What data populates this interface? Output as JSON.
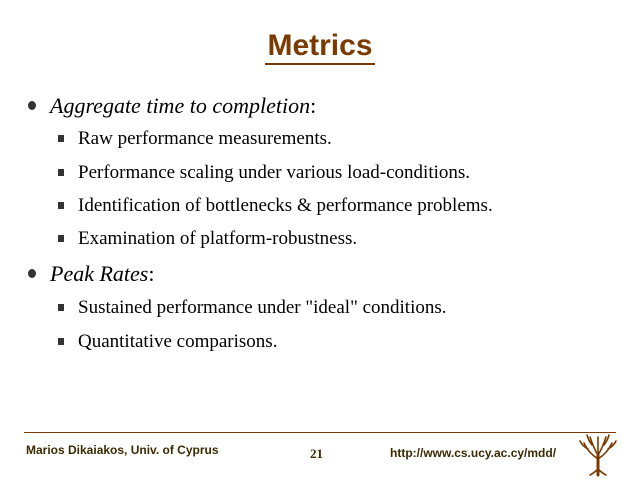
{
  "slide": {
    "title": "Metrics"
  },
  "bullets": [
    {
      "label": "Aggregate time to completion",
      "suffix": ":",
      "items": [
        "Raw performance measurements.",
        "Performance scaling under various load-conditions.",
        "Identification of bottlenecks & performance problems.",
        "Examination of platform-robustness."
      ]
    },
    {
      "label": "Peak Rates",
      "suffix": ":",
      "items": [
        "Sustained performance under \"ideal\" conditions.",
        "Quantitative comparisons."
      ]
    }
  ],
  "footer": {
    "author": "Marios Dikaiakos, Univ. of Cyprus",
    "page_number": "21",
    "url": "http://www.cs.ucy.ac.cy/mdd/",
    "logo_icon": "university-tree-logo"
  },
  "colors": {
    "title": "#7a3a00",
    "rule": "#7a3a00",
    "footer_text": "#3a2a00"
  }
}
